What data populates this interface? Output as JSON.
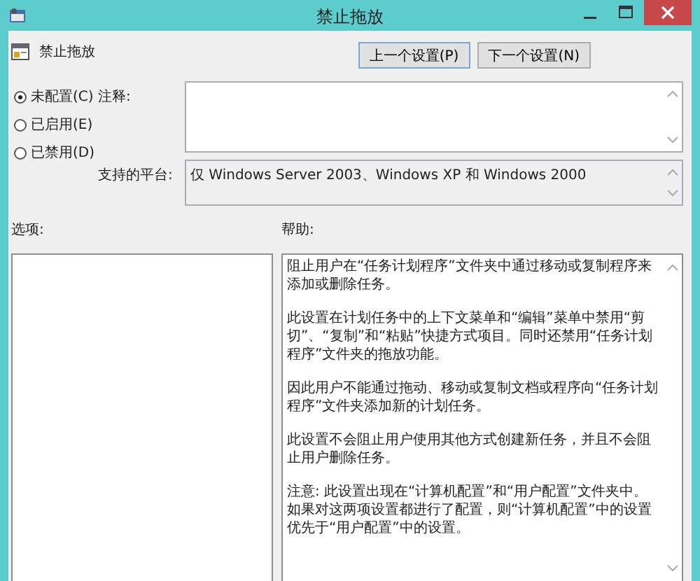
{
  "window": {
    "title": "禁止拖放"
  },
  "policy": {
    "name": "禁止拖放"
  },
  "nav_buttons": [
    "上一个设置(P)",
    "下一个设置(N)"
  ],
  "state_options": [
    {
      "label": "未配置(C)",
      "selected": true
    },
    {
      "label": "已启用(E)",
      "selected": false
    },
    {
      "label": "已禁用(D)",
      "selected": false
    }
  ],
  "comment": {
    "label": "注释:"
  },
  "supported_on": {
    "label": "支持的平台:",
    "value": "仅 Windows Server 2003、Windows XP 和 Windows 2000"
  },
  "options": {
    "label": "选项:"
  },
  "help": {
    "label": "帮助:",
    "paragraphs": [
      "阻止用户在“任务计划程序”文件夹中通过移动或复制程序来添加或删除任务。",
      "此设置在计划任务中的上下文菜单和“编辑”菜单中禁用“剪切”、“复制”和“粘贴”快捷方式项目。同时还禁用“任务计划程序”文件夹的拖放功能。",
      "因此用户不能通过拖动、移动或复制文档或程序向“任务计划程序”文件夹添加新的计划任务。",
      "此设置不会阻止用户使用其他方式创建新任务，并且不会阻止用户删除任务。",
      "注意: 此设置出现在“计算机配置”和“用户配置”文件夹中。如果对这两项设置都进行了配置，则“计算机配置”中的设置优先于“用户配置”中的设置。"
    ]
  }
}
